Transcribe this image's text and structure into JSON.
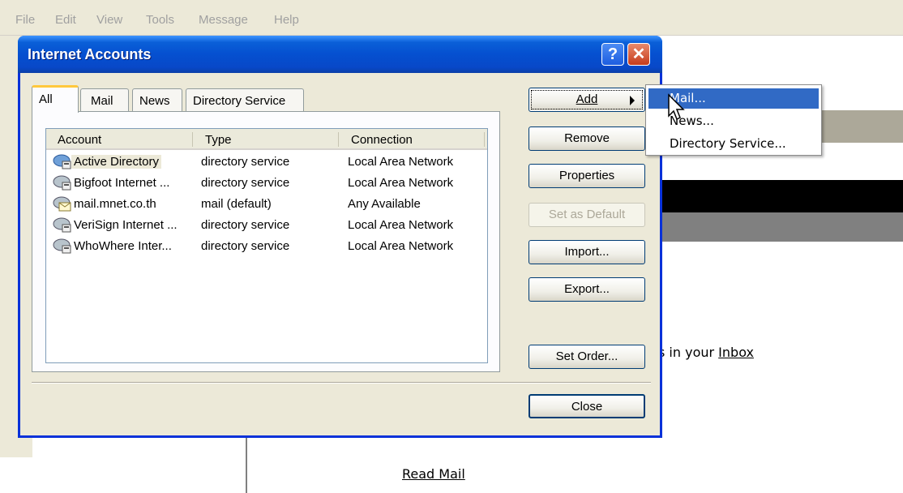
{
  "menubar": {
    "items": [
      "File",
      "Edit",
      "View",
      "Tools",
      "Message",
      "Help"
    ]
  },
  "background": {
    "inbox_prefix": "s in your",
    "inbox_link": "Inbox",
    "read_mail_link": "Read Mail"
  },
  "dialog": {
    "title": "Internet Accounts",
    "help_glyph": "?",
    "close_glyph": "✕",
    "tabs": [
      "All",
      "Mail",
      "News",
      "Directory Service"
    ],
    "active_tab": "All",
    "columns": [
      "Account",
      "Type",
      "Connection"
    ],
    "rows": [
      {
        "account": "Active Directory",
        "type": "directory service",
        "connection": "Local Area Network",
        "icon": "directory-service-icon"
      },
      {
        "account": "Bigfoot Internet ...",
        "type": "directory service",
        "connection": "Local Area Network",
        "icon": "directory-service-icon"
      },
      {
        "account": "mail.mnet.co.th",
        "type": "mail (default)",
        "connection": "Any Available",
        "icon": "mail-account-icon"
      },
      {
        "account": "VeriSign Internet ...",
        "type": "directory service",
        "connection": "Local Area Network",
        "icon": "directory-service-icon"
      },
      {
        "account": "WhoWhere Inter...",
        "type": "directory service",
        "connection": "Local Area Network",
        "icon": "directory-service-icon"
      }
    ],
    "buttons": {
      "add": "Add",
      "remove": "Remove",
      "properties": "Properties",
      "set_default": "Set as Default",
      "import": "Import...",
      "export": "Export...",
      "set_order": "Set Order...",
      "close": "Close"
    }
  },
  "add_menu": {
    "items": [
      "Mail...",
      "News...",
      "Directory Service..."
    ],
    "highlighted": "Mail..."
  },
  "colors": {
    "title_blue": "#0550d0",
    "menu_highlight": "#316ac5",
    "dialog_face": "#ece9d8",
    "tab_accent": "#ffc83c"
  }
}
